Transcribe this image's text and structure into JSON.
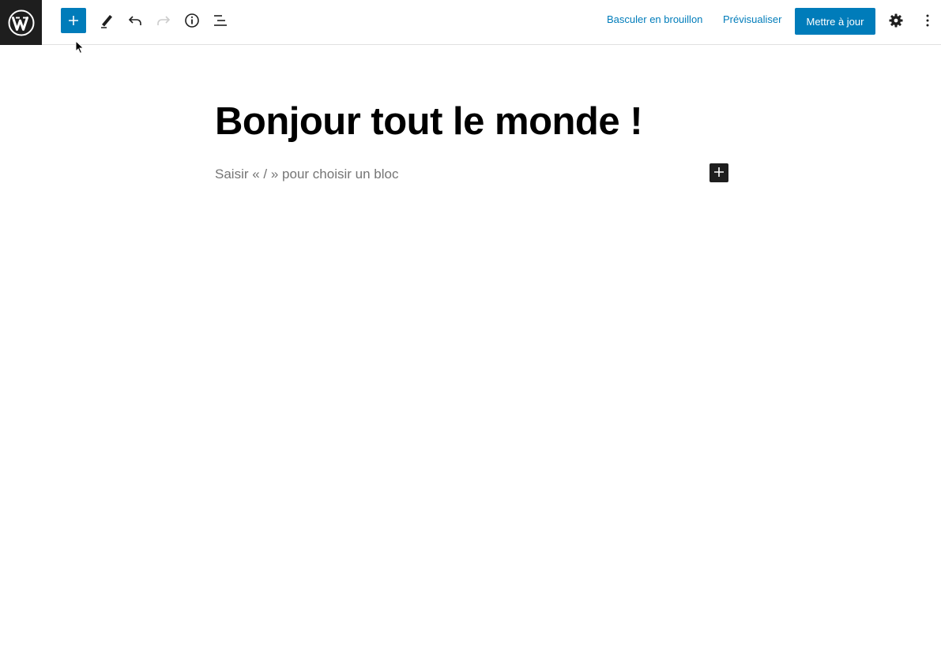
{
  "toolbar": {
    "logo_icon": "wordpress-logo-icon",
    "tools": [
      {
        "name": "add-block",
        "icon": "plus-icon",
        "active": true
      },
      {
        "name": "tools",
        "icon": "pencil-icon"
      },
      {
        "name": "undo",
        "icon": "undo-icon"
      },
      {
        "name": "redo",
        "icon": "redo-icon",
        "disabled": true
      },
      {
        "name": "details",
        "icon": "info-icon"
      },
      {
        "name": "list-view",
        "icon": "list-view-icon"
      }
    ],
    "switch_to_draft_label": "Basculer en brouillon",
    "preview_label": "Prévisualiser",
    "update_label": "Mettre à jour",
    "settings_icon": "gear-icon",
    "more_icon": "vertical-ellipsis-icon"
  },
  "editor": {
    "title": "Bonjour tout le monde !",
    "placeholder": "Saisir « / » pour choisir un bloc",
    "appender_icon": "plus-icon"
  },
  "colors": {
    "accent": "#007cba",
    "dark": "#1e1e1e",
    "muted_text": "#757575",
    "disabled": "#cccccc"
  }
}
